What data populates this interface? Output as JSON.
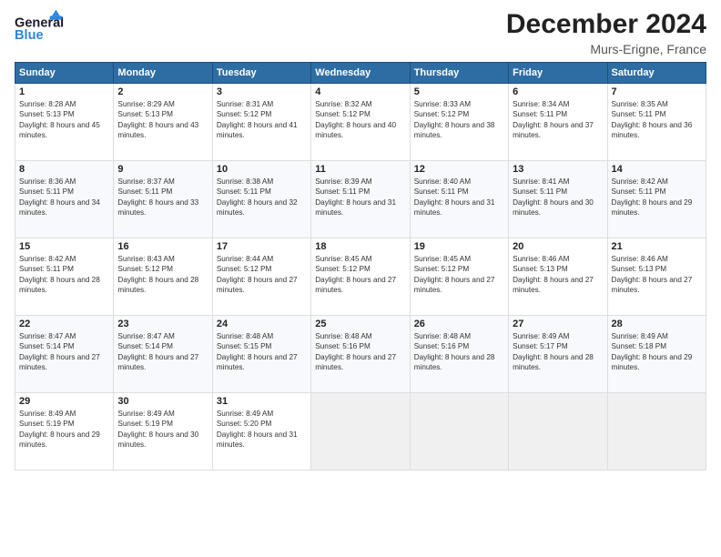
{
  "header": {
    "logo_line1": "General",
    "logo_line2": "Blue",
    "title": "December 2024",
    "subtitle": "Murs-Erigne, France"
  },
  "calendar": {
    "days_of_week": [
      "Sunday",
      "Monday",
      "Tuesday",
      "Wednesday",
      "Thursday",
      "Friday",
      "Saturday"
    ],
    "weeks": [
      [
        null,
        null,
        {
          "day": "3",
          "sunrise": "Sunrise: 8:31 AM",
          "sunset": "Sunset: 5:12 PM",
          "daylight": "Daylight: 8 hours and 41 minutes."
        },
        {
          "day": "4",
          "sunrise": "Sunrise: 8:32 AM",
          "sunset": "Sunset: 5:12 PM",
          "daylight": "Daylight: 8 hours and 40 minutes."
        },
        {
          "day": "5",
          "sunrise": "Sunrise: 8:33 AM",
          "sunset": "Sunset: 5:12 PM",
          "daylight": "Daylight: 8 hours and 38 minutes."
        },
        {
          "day": "6",
          "sunrise": "Sunrise: 8:34 AM",
          "sunset": "Sunset: 5:11 PM",
          "daylight": "Daylight: 8 hours and 37 minutes."
        },
        {
          "day": "7",
          "sunrise": "Sunrise: 8:35 AM",
          "sunset": "Sunset: 5:11 PM",
          "daylight": "Daylight: 8 hours and 36 minutes."
        }
      ],
      [
        {
          "day": "1",
          "sunrise": "Sunrise: 8:28 AM",
          "sunset": "Sunset: 5:13 PM",
          "daylight": "Daylight: 8 hours and 45 minutes."
        },
        {
          "day": "2",
          "sunrise": "Sunrise: 8:29 AM",
          "sunset": "Sunset: 5:13 PM",
          "daylight": "Daylight: 8 hours and 43 minutes."
        },
        {
          "day": "8",
          "sunrise": "Sunrise: 8:36 AM",
          "sunset": "Sunset: 5:11 PM",
          "daylight": "Daylight: 8 hours and 34 minutes."
        },
        {
          "day": "9",
          "sunrise": "Sunrise: 8:37 AM",
          "sunset": "Sunset: 5:11 PM",
          "daylight": "Daylight: 8 hours and 33 minutes."
        },
        {
          "day": "10",
          "sunrise": "Sunrise: 8:38 AM",
          "sunset": "Sunset: 5:11 PM",
          "daylight": "Daylight: 8 hours and 32 minutes."
        },
        {
          "day": "11",
          "sunrise": "Sunrise: 8:39 AM",
          "sunset": "Sunset: 5:11 PM",
          "daylight": "Daylight: 8 hours and 31 minutes."
        },
        {
          "day": "12",
          "sunrise": "Sunrise: 8:40 AM",
          "sunset": "Sunset: 5:11 PM",
          "daylight": "Daylight: 8 hours and 31 minutes."
        }
      ],
      [
        {
          "day": "13",
          "sunrise": "Sunrise: 8:41 AM",
          "sunset": "Sunset: 5:11 PM",
          "daylight": "Daylight: 8 hours and 30 minutes."
        },
        {
          "day": "14",
          "sunrise": "Sunrise: 8:42 AM",
          "sunset": "Sunset: 5:11 PM",
          "daylight": "Daylight: 8 hours and 29 minutes."
        },
        {
          "day": "15",
          "sunrise": "Sunrise: 8:42 AM",
          "sunset": "Sunset: 5:11 PM",
          "daylight": "Daylight: 8 hours and 28 minutes."
        },
        {
          "day": "16",
          "sunrise": "Sunrise: 8:43 AM",
          "sunset": "Sunset: 5:12 PM",
          "daylight": "Daylight: 8 hours and 28 minutes."
        },
        {
          "day": "17",
          "sunrise": "Sunrise: 8:44 AM",
          "sunset": "Sunset: 5:12 PM",
          "daylight": "Daylight: 8 hours and 27 minutes."
        },
        {
          "day": "18",
          "sunrise": "Sunrise: 8:45 AM",
          "sunset": "Sunset: 5:12 PM",
          "daylight": "Daylight: 8 hours and 27 minutes."
        },
        {
          "day": "19",
          "sunrise": "Sunrise: 8:45 AM",
          "sunset": "Sunset: 5:12 PM",
          "daylight": "Daylight: 8 hours and 27 minutes."
        }
      ],
      [
        {
          "day": "20",
          "sunrise": "Sunrise: 8:46 AM",
          "sunset": "Sunset: 5:13 PM",
          "daylight": "Daylight: 8 hours and 27 minutes."
        },
        {
          "day": "21",
          "sunrise": "Sunrise: 8:46 AM",
          "sunset": "Sunset: 5:13 PM",
          "daylight": "Daylight: 8 hours and 27 minutes."
        },
        {
          "day": "22",
          "sunrise": "Sunrise: 8:47 AM",
          "sunset": "Sunset: 5:14 PM",
          "daylight": "Daylight: 8 hours and 27 minutes."
        },
        {
          "day": "23",
          "sunrise": "Sunrise: 8:47 AM",
          "sunset": "Sunset: 5:14 PM",
          "daylight": "Daylight: 8 hours and 27 minutes."
        },
        {
          "day": "24",
          "sunrise": "Sunrise: 8:48 AM",
          "sunset": "Sunset: 5:15 PM",
          "daylight": "Daylight: 8 hours and 27 minutes."
        },
        {
          "day": "25",
          "sunrise": "Sunrise: 8:48 AM",
          "sunset": "Sunset: 5:16 PM",
          "daylight": "Daylight: 8 hours and 27 minutes."
        },
        {
          "day": "26",
          "sunrise": "Sunrise: 8:48 AM",
          "sunset": "Sunset: 5:16 PM",
          "daylight": "Daylight: 8 hours and 28 minutes."
        }
      ],
      [
        {
          "day": "27",
          "sunrise": "Sunrise: 8:49 AM",
          "sunset": "Sunset: 5:17 PM",
          "daylight": "Daylight: 8 hours and 28 minutes."
        },
        {
          "day": "28",
          "sunrise": "Sunrise: 8:49 AM",
          "sunset": "Sunset: 5:18 PM",
          "daylight": "Daylight: 8 hours and 29 minutes."
        },
        {
          "day": "29",
          "sunrise": "Sunrise: 8:49 AM",
          "sunset": "Sunset: 5:19 PM",
          "daylight": "Daylight: 8 hours and 29 minutes."
        },
        {
          "day": "30",
          "sunrise": "Sunrise: 8:49 AM",
          "sunset": "Sunset: 5:19 PM",
          "daylight": "Daylight: 8 hours and 30 minutes."
        },
        {
          "day": "31",
          "sunrise": "Sunrise: 8:49 AM",
          "sunset": "Sunset: 5:20 PM",
          "daylight": "Daylight: 8 hours and 31 minutes."
        },
        null,
        null
      ]
    ]
  }
}
